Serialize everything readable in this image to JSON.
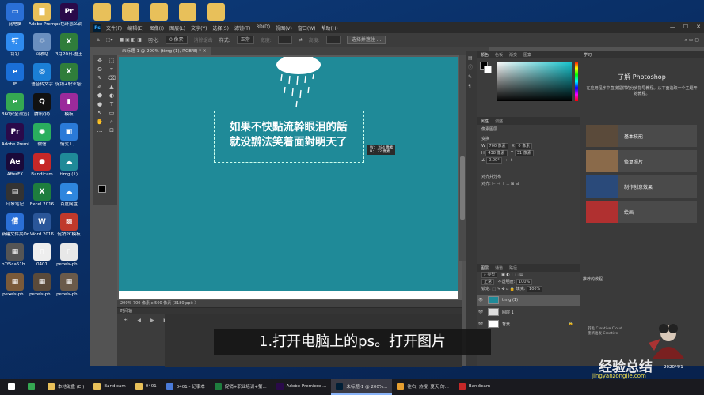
{
  "desktop": {
    "icons": [
      {
        "label": "此电脑",
        "color": "#2a6fd6",
        "glyph": "▭"
      },
      {
        "label": "Adobe Premie...",
        "color": "#e8c05a",
        "glyph": "▇"
      },
      {
        "label": "ps色环怎么调出来?",
        "color": "#2a0a4a",
        "glyph": "Pr"
      },
      {
        "label": "钉钉",
        "color": "#2e8bf0",
        "glyph": "钉"
      },
      {
        "label": "回收站",
        "color": "#6a8fbf",
        "glyph": "♲"
      },
      {
        "label": "3月20日-吾王说电脑7...",
        "color": "#2f7d3a",
        "glyph": "X"
      },
      {
        "label": "IE",
        "color": "#1a6fd8",
        "glyph": "e"
      },
      {
        "label": "语音转文字",
        "color": "#1b7fd6",
        "glyph": "◎"
      },
      {
        "label": "促销+职业培训+第4批...",
        "color": "#2f7d3a",
        "glyph": "X"
      },
      {
        "label": "360安全浏览器",
        "color": "#35a852",
        "glyph": "e"
      },
      {
        "label": "腾讯QQ",
        "color": "#111",
        "glyph": "Q"
      },
      {
        "label": "模板",
        "color": "#9b2a9b",
        "glyph": "▮"
      },
      {
        "label": "Adobe Premie...",
        "color": "#2a0a4a",
        "glyph": "Pr"
      },
      {
        "label": "微信",
        "color": "#2aae5e",
        "glyph": "◉"
      },
      {
        "label": "情式工厂",
        "color": "#2a7ad8",
        "glyph": "▣"
      },
      {
        "label": "AfterFX",
        "color": "#1a0a3a",
        "glyph": "Ae"
      },
      {
        "label": "Bandicam",
        "color": "#c62828",
        "glyph": "●"
      },
      {
        "label": "timg (1)",
        "color": "#1f8a98",
        "glyph": "☁"
      },
      {
        "label": "印象笔记",
        "color": "#333",
        "glyph": "▤"
      },
      {
        "label": "Excel 2016",
        "color": "#1e7d3e",
        "glyph": "X"
      },
      {
        "label": "百度网盘",
        "color": "#2e86de",
        "glyph": "☁"
      },
      {
        "label": "新建文件夹Online",
        "color": "#2a6fd6",
        "glyph": "倩"
      },
      {
        "label": "Word 2016",
        "color": "#2a5699",
        "glyph": "W"
      },
      {
        "label": "促销PC模板",
        "color": "#c0392b",
        "glyph": "▩"
      },
      {
        "label": "b7f5ca51b...",
        "color": "#555",
        "glyph": "▦"
      },
      {
        "label": "0401",
        "color": "#eee",
        "glyph": "▯"
      },
      {
        "label": "pexels-ph...",
        "color": "#e8e8e8",
        "glyph": "▯"
      },
      {
        "label": "pexels-ph...",
        "color": "#7a5a3a",
        "glyph": "▦"
      },
      {
        "label": "pexels-ph...",
        "color": "#5a4a3a",
        "glyph": "▦"
      },
      {
        "label": "pexels-ph...",
        "color": "#6a5a4a",
        "glyph": "▦"
      }
    ],
    "top_folders": [
      "",
      "",
      "",
      "",
      ""
    ]
  },
  "ps": {
    "menus": [
      "文件(F)",
      "编辑(E)",
      "图像(I)",
      "图层(L)",
      "文字(Y)",
      "选择(S)",
      "滤镜(T)",
      "3D(D)",
      "视图(V)",
      "窗口(W)",
      "帮助(H)"
    ],
    "window_buttons": [
      "—",
      "☐",
      "✕"
    ],
    "options": {
      "feather_label": "羽化:",
      "feather_value": "0 像素",
      "antialias": "消除锯齿",
      "style_label": "样式:",
      "style_value": "正常",
      "width_label": "宽度:",
      "height_label": "高度:",
      "select_mask": "选择并遮住 ..."
    },
    "doc_tab": "未标题-1 @ 200% (timg (1), RGB/8) *  ✕",
    "tools": [
      "✥",
      "⬚",
      "ʘ",
      "⌗",
      "✎",
      "⌫",
      "✐",
      "▲",
      "⬟",
      "◐",
      "●",
      "T",
      "↖",
      "▭",
      "✋",
      "⌕",
      "…",
      "⊡"
    ],
    "canvas": {
      "text_line1": "如果不快點流幹眼泪的話",
      "text_line2": "就没辦法笑着面對明天了",
      "dim_w": "W： 284 像素",
      "dim_h": "H： 72 像素",
      "bg_color": "#1f8a98"
    },
    "status": "200%  700 像素 x 500 像素 (3180 ppi)  〉",
    "timeline": {
      "title": "时间轴",
      "controls": [
        "⏮",
        "◀",
        "▶",
        "▶|",
        "🔊",
        "⚙",
        "✂",
        "▢"
      ]
    },
    "color_panel": {
      "tabs": [
        "颜色",
        "色板",
        "渐变",
        "图案"
      ]
    },
    "props_panel": {
      "tabs": [
        "属性",
        "调整"
      ],
      "pixel_layer": "像素图层",
      "transform_title": "变换",
      "w_label": "W",
      "w_value": "700 像素",
      "x_label": "X",
      "x_value": "0 像素",
      "h_label": "H",
      "h_value": "438 像素",
      "y_label": "Y",
      "y_value": "31 像素",
      "angle_value": "0.00°",
      "align_title": "对齐并分布",
      "align_label": "对齐:"
    },
    "layers_panel": {
      "tabs": [
        "图层",
        "通道",
        "路径"
      ],
      "filter": "类型",
      "blend": "正常",
      "opacity_label": "不透明度:",
      "opacity": "100%",
      "lock_label": "锁定:",
      "fill_label": "填充:",
      "fill": "100%",
      "layers": [
        {
          "name": "timg (1)",
          "thumb": "#1f8a98",
          "active": true
        },
        {
          "name": "图层 1",
          "thumb": "#dddddd",
          "active": false
        },
        {
          "name": "背景",
          "thumb": "#ffffff",
          "active": false
        }
      ]
    },
    "learn_panel": {
      "tab": "学习",
      "title": "了解 Photoshop",
      "desc": "在应用程序中直接提供的分步指导教程。从下面选取一个主题开始教程。",
      "items": [
        {
          "label": "基本技能",
          "color": "#5a4a3a"
        },
        {
          "label": "修复照片",
          "color": "#8a6a4a"
        },
        {
          "label": "制作创意效果",
          "color": "#2a4a7a"
        },
        {
          "label": "绘画",
          "color": "#b03030"
        }
      ],
      "recommended": "推荐的教程",
      "logo_text1": "羽毛 Creative Cloud",
      "logo_text2": "重新出发 Creative"
    }
  },
  "subtitle": "1.打开电脑上的ps。打开图片",
  "watermark": "经验总结",
  "watermark_url": "jingyanzongjie.com",
  "date_overlay": "2020/4/1",
  "taskbar": {
    "items": [
      {
        "label": "",
        "color": "#fff",
        "active": false
      },
      {
        "label": "",
        "color": "#35a852",
        "active": false
      },
      {
        "label": "本地磁盘 (E:)",
        "color": "#e8c05a",
        "active": false
      },
      {
        "label": "Bandicam",
        "color": "#e8c05a",
        "active": false
      },
      {
        "label": "0401",
        "color": "#e8c05a",
        "active": false
      },
      {
        "label": "0401 - 记事本",
        "color": "#4a7ad8",
        "active": false
      },
      {
        "label": "促销+职业培训+第...",
        "color": "#1e7d3e",
        "active": false
      },
      {
        "label": "Adobe Premiere ...",
        "color": "#2a0a4a",
        "active": false
      },
      {
        "label": "未标题-1 @ 200%...",
        "color": "#001e36",
        "active": true
      },
      {
        "label": "往右, 热搜, 夏天 的...",
        "color": "#e8a030",
        "active": false
      },
      {
        "label": "Bandicam",
        "color": "#c62828",
        "active": false
      }
    ]
  }
}
